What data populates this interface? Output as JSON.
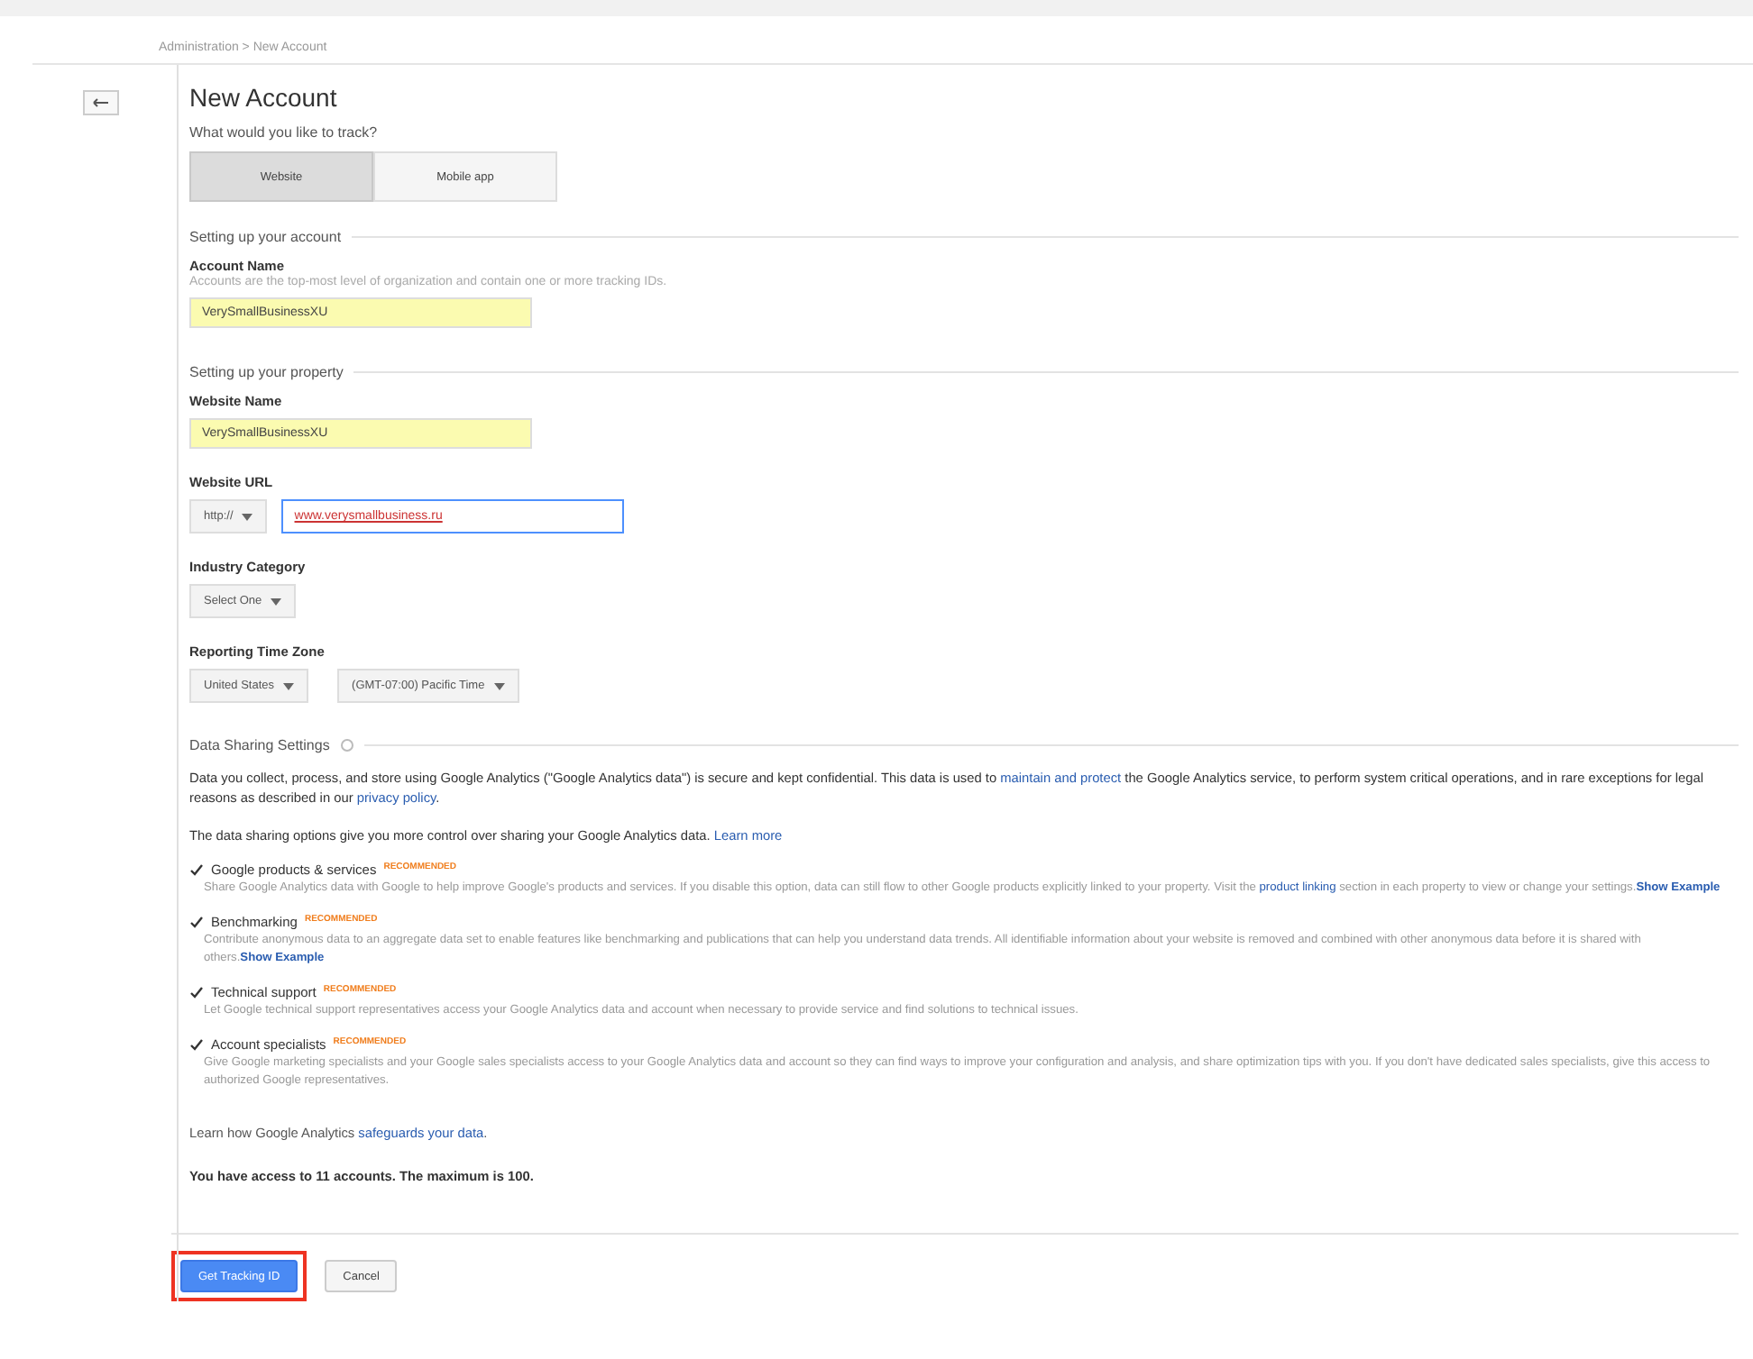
{
  "breadcrumb": "Administration > New Account",
  "title": "New Account",
  "question": "What would you like to track?",
  "track_options": [
    {
      "label": "Website",
      "selected": true
    },
    {
      "label": "Mobile app",
      "selected": false
    }
  ],
  "account_section": {
    "heading": "Setting up your account",
    "label": "Account Name",
    "hint": "Accounts are the top-most level of organization and contain one or more tracking IDs.",
    "value": "VerySmallBusinessXU"
  },
  "property_section": {
    "heading": "Setting up your property",
    "website_name": {
      "label": "Website Name",
      "value": "VerySmallBusinessXU"
    },
    "website_url": {
      "label": "Website URL",
      "protocol": "http://",
      "value": "www.verysmallbusiness.ru"
    },
    "industry": {
      "label": "Industry Category",
      "value": "Select One"
    },
    "time_zone": {
      "label": "Reporting Time Zone",
      "country": "United States",
      "zone": "(GMT-07:00) Pacific Time"
    }
  },
  "data_sharing": {
    "heading": "Data Sharing Settings",
    "intro": "Data you collect, process, and store using Google Analytics (\"Google Analytics data\") is secure and kept confidential. This data is used to ",
    "intro_link": "maintain and protect",
    "intro_mid": " the Google Analytics service, to perform system critical operations, and in rare exceptions for legal reasons as described in our ",
    "intro_link2": "privacy policy",
    "intro_end": ".",
    "options_text": "The data sharing options give you more control over sharing your Google Analytics data. ",
    "options_link": "Learn more",
    "options": [
      {
        "label": "Google products & services",
        "badge": "RECOMMENDED",
        "checked": true,
        "description": "Share Google Analytics data with Google to help improve Google's products and services. If you disable this option, data can still flow to other Google products explicitly linked to your property. Visit the ",
        "link": "product linking",
        "description_end": " section in each property to view or change your settings.",
        "example": "Show Example"
      },
      {
        "label": "Benchmarking",
        "badge": "RECOMMENDED",
        "checked": true,
        "description": "Contribute anonymous data to an aggregate data set to enable features like benchmarking and publications that can help you understand data trends. All identifiable information about your website is removed and combined with other anonymous data before it is shared with others.",
        "example": "Show Example"
      },
      {
        "label": "Technical support",
        "badge": "RECOMMENDED",
        "checked": true,
        "description": "Let Google technical support representatives access your Google Analytics data and account when necessary to provide service and find solutions to technical issues."
      },
      {
        "label": "Account specialists",
        "badge": "RECOMMENDED",
        "checked": true,
        "description": "Give Google marketing specialists and your Google sales specialists access to your Google Analytics data and account so they can find ways to improve your configuration and analysis, and share optimization tips with you. If you don't have dedicated sales specialists, give this access to authorized Google representatives."
      }
    ],
    "learn_text": "Learn how Google Analytics ",
    "learn_link": "safeguards your data",
    "learn_end": ".",
    "access_note": "You have access to 11 accounts. The maximum is 100."
  },
  "buttons": [
    {
      "label": "Get Tracking ID",
      "kind": "primary",
      "highlighted": true
    },
    {
      "label": "Cancel",
      "kind": "secondary",
      "highlighted": false
    }
  ]
}
